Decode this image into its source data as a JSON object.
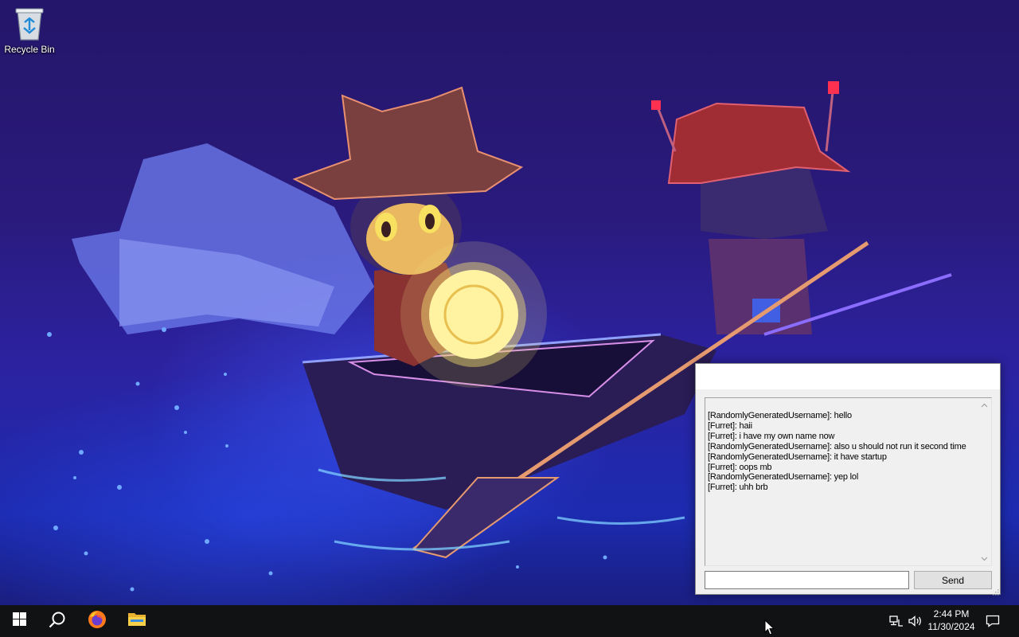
{
  "desktop": {
    "icons": [
      {
        "label": "Recycle Bin",
        "icon": "recycle-bin-icon"
      }
    ]
  },
  "chat": {
    "title": "",
    "messages": [
      "[RandomlyGeneratedUsername]: hello",
      "[Furret]: haii",
      "[Furret]: i have my own name now",
      "[RandomlyGeneratedUsername]: also u should not run it second time",
      "[RandomlyGeneratedUsername]: it have startup",
      "[Furret]: oops mb",
      "[RandomlyGeneratedUsername]: yep lol",
      "[Furret]: uhh brb"
    ],
    "input": {
      "value": "",
      "placeholder": ""
    },
    "send_label": "Send"
  },
  "taskbar": {
    "pinned": [
      "windows-start-icon",
      "search-icon",
      "firefox-icon",
      "file-explorer-icon"
    ],
    "tray": [
      "network-icon",
      "volume-icon"
    ],
    "time": "2:44 PM",
    "date": "11/30/2024"
  },
  "colors": {
    "taskbar_bg": "#101214",
    "window_bg": "#f0f0f0",
    "wallpaper_sky": "#2a1a7c",
    "wallpaper_water": "#1c2bb0"
  }
}
